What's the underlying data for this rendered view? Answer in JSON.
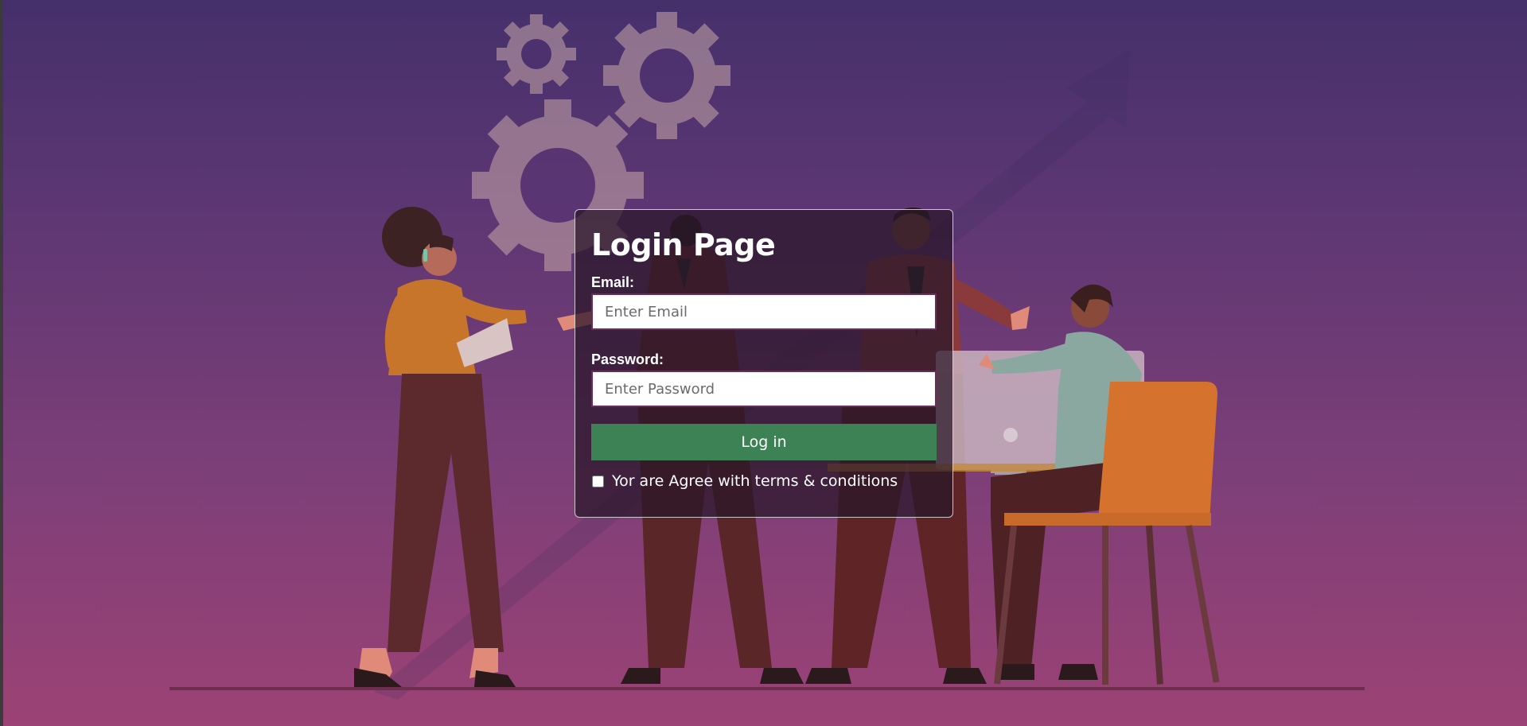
{
  "login": {
    "title": "Login Page",
    "email_label": "Email:",
    "email_placeholder": "Enter Email",
    "email_value": "",
    "password_label": "Password:",
    "password_placeholder": "Enter Password",
    "password_value": "",
    "submit_label": "Log in",
    "terms_label": "Yor are Agree with terms & conditions",
    "terms_checked": false
  },
  "colors": {
    "background_top": "#45306b",
    "background_bottom": "#9c4275",
    "card_background": "#281628",
    "button": "#3d8254",
    "input_border": "#6a2d5a"
  },
  "illustration": {
    "name": "teamwork-illustration",
    "elements": [
      "gears-icon",
      "growth-arrow-icon",
      "people",
      "computer-monitor",
      "chair"
    ]
  }
}
